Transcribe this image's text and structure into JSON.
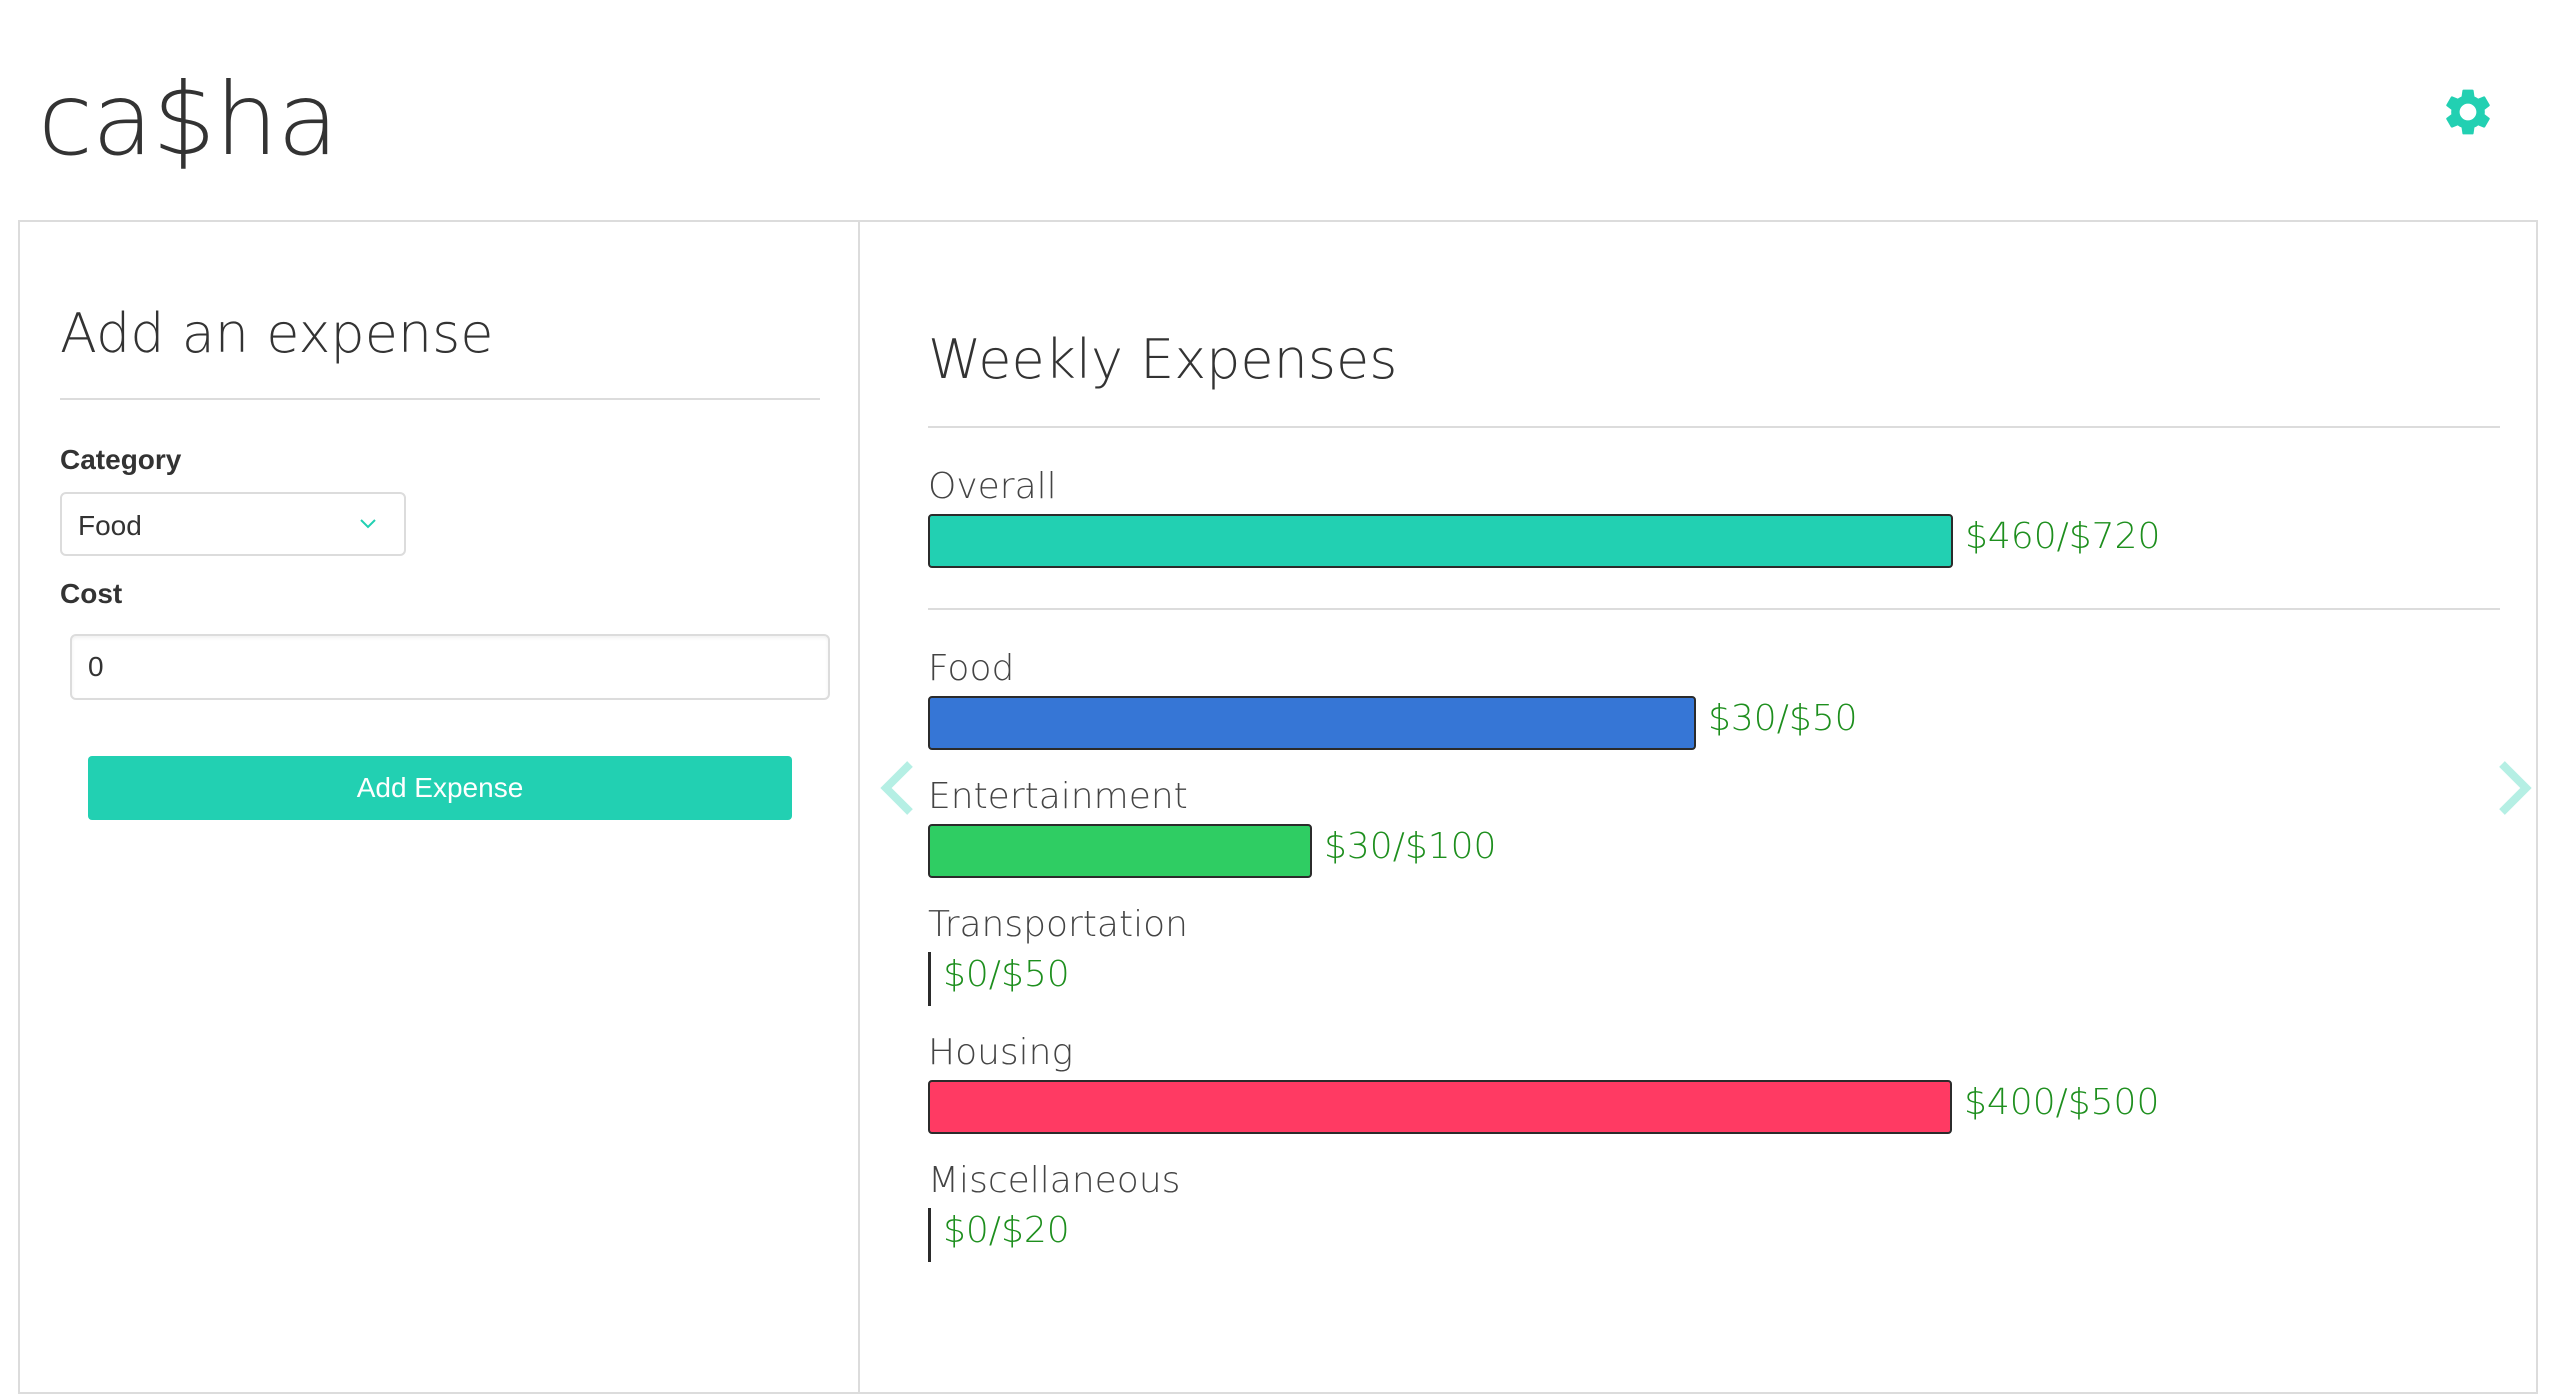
{
  "app": {
    "logo": "ca$ha",
    "accent_color": "#22d0b2",
    "settings_icon": "gear-icon"
  },
  "add_expense": {
    "title": "Add an expense",
    "category_label": "Category",
    "category_value": "Food",
    "cost_label": "Cost",
    "cost_value": "0",
    "button_label": "Add Expense"
  },
  "weekly": {
    "title": "Weekly Expenses",
    "overall": {
      "label": "Overall",
      "spent": 460,
      "budget": 720,
      "value_text": "$460/$720",
      "color": "#22d0b2"
    },
    "categories": [
      {
        "label": "Food",
        "spent": 30,
        "budget": 50,
        "value_text": "$30/$50",
        "color": "#3676d6"
      },
      {
        "label": "Entertainment",
        "spent": 30,
        "budget": 100,
        "value_text": "$30/$100",
        "color": "#2fcd63"
      },
      {
        "label": "Transportation",
        "spent": 0,
        "budget": 50,
        "value_text": "$0/$50",
        "color": "#3676d6"
      },
      {
        "label": "Housing",
        "spent": 400,
        "budget": 500,
        "value_text": "$400/$500",
        "color": "#ff3a63"
      },
      {
        "label": "Miscellaneous",
        "spent": 0,
        "budget": 20,
        "value_text": "$0/$20",
        "color": "#3676d6"
      }
    ],
    "prev_icon": "chevron-left-icon",
    "next_icon": "chevron-right-icon"
  }
}
